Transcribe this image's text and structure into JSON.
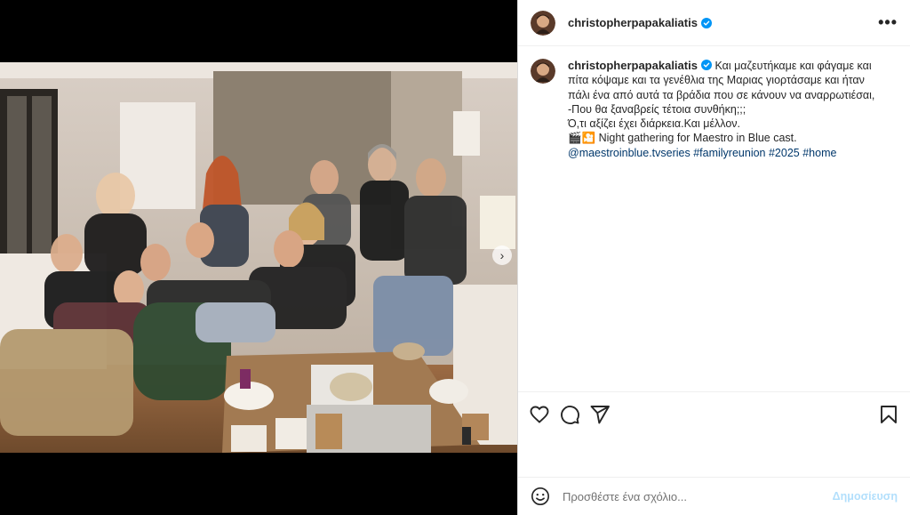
{
  "post": {
    "username": "christopherpapakaliatis",
    "more_icon": "more-horizontal-icon",
    "caption_lines": [
      "Και μαζευτήκαμε και φάγαμε και",
      "πίτα κόψαμε και τα γενέθλια της Μαριας γιορτάσαμε και ήταν",
      "πάλι ένα από αυτά τα βράδια που σε κάνουν να αναρρωτιέσαι,",
      "-Που θα ξαναβρείς τέτοια συνθήκη;;;",
      "Ό,τι αξίζει έχει διάρκεια.Και μέλλον.",
      "🎬🎦 Night gathering for Maestro in Blue cast."
    ],
    "tags": "@maestroinblue.tvseries #familyreunion #2025 #home"
  },
  "comment": {
    "placeholder": "Προσθέστε ένα σχόλιο...",
    "post_label": "Δημοσίευση"
  },
  "colors": {
    "verified": "#0095f6",
    "link": "#00376b",
    "post_disabled": "#b2dffc"
  }
}
